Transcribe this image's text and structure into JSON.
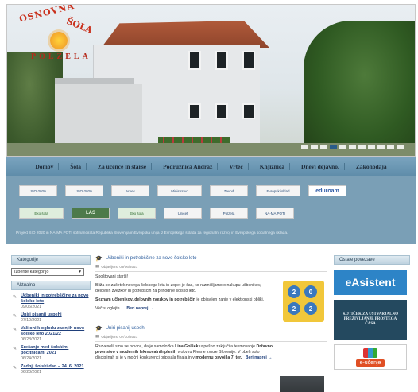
{
  "header": {
    "logo_line1": "OSNOVNA",
    "logo_line2": "ŠOLA",
    "logo_line3": "POLZELA",
    "slider_dot_count": 11,
    "slider_active_index": 3
  },
  "nav": {
    "items": [
      "Domov",
      "Šola",
      "Za učence in starše",
      "Podružnica Andraž",
      "Vrtec",
      "Knjižnica",
      "Dnevi dejavno.",
      "Zakonodaja"
    ]
  },
  "partners": {
    "row1": [
      "SIO-2020",
      "SIO-2020",
      "Arnes",
      "Ministrstvo",
      "Zavod",
      "Evropski sklad",
      "eduroam"
    ],
    "row2": [
      "Eko šola",
      "LAS",
      "Eko šola",
      "Unicef",
      "Polzela",
      "NA-MA POTI"
    ],
    "note": "Projekt SIO 2020 in NA-MA POTI sofinancirata Republika Slovenija in Evropska unija iz Evropskega sklada za regionalni razvoj in Evropskega socialnega sklada."
  },
  "sidebar": {
    "categories_title": "Kategorije",
    "select_placeholder": "Izberite kategorijo",
    "news_title": "Aktualno",
    "news": [
      {
        "title": "Učbeniki in potrebščine za novo šolsko leto",
        "date": "09/06/2021"
      },
      {
        "title": "Uniri pisanij uspehi",
        "date": "07/10/2021"
      },
      {
        "title": "Valiloni k oglodu zadnjih novo šolsko leto 2021/22",
        "date": "06/28/2021"
      },
      {
        "title": "Srečanje med šolskimi počitnicami 2021",
        "date": "06/24/2021"
      },
      {
        "title": "Zadnji šolski dan – 24. 6. 2021",
        "date": "06/23/2021"
      }
    ]
  },
  "main": {
    "post1": {
      "title": "Učbeniki in potrebščine za novo šolsko leto",
      "meta": "Objavljeno 09/06/2021",
      "para1": "Spoštovani starši!",
      "para2": "Bliža se začetek novega šolskega leta in zopet je čas, ko razmišljamo o nakupu učbenikov, delovnih zvezkov in potrebščin za prihodnje šolsko leto.",
      "para3_bold": "Seznam učbenikov, delovnih zvezkov in potrebščin",
      "para3_rest": "je objavljen zanje v elektronski obliki.",
      "more_prefix": "Več si oglejte...",
      "more_link": "Beri naprej →",
      "badge_year_top": [
        "2",
        "0"
      ],
      "badge_year_bottom": [
        "2",
        "2"
      ]
    },
    "post2": {
      "title": "Uniri pisanij uspehi",
      "meta": "Objavljeno 07/10/2021",
      "para_prefix": "Razveselil smo se novice, da je samoložka",
      "para_name": "Lina Golšek",
      "para_mid": "uspešno zaključila tekmovanje",
      "para_bold2": "Državno prvenstvo v modernih lekmovalnih plesih",
      "para_rest": "v okviru Plesne zveze Slovenije. V obeh solo disciplinah si je v močni konkurenci pripisala finala in v",
      "para_bold3": "modernu osvojila 7. ter.",
      "more_link": "Beri naprej →"
    }
  },
  "right": {
    "title": "Ostale povezave",
    "ad1": "eAsistent",
    "ad2_line1": "KOTIČEK ZA USTVARJALNO",
    "ad2_line2": "PREŽIVLJANJE PROSTEGA",
    "ad2_line3": "ČASA",
    "ad3": "e-učenje"
  },
  "colors": {
    "nav_bg": "#6b97b3",
    "strip_bg": "#7a9fb6",
    "link": "#1f3f7a",
    "easistent": "#2d84c7"
  }
}
